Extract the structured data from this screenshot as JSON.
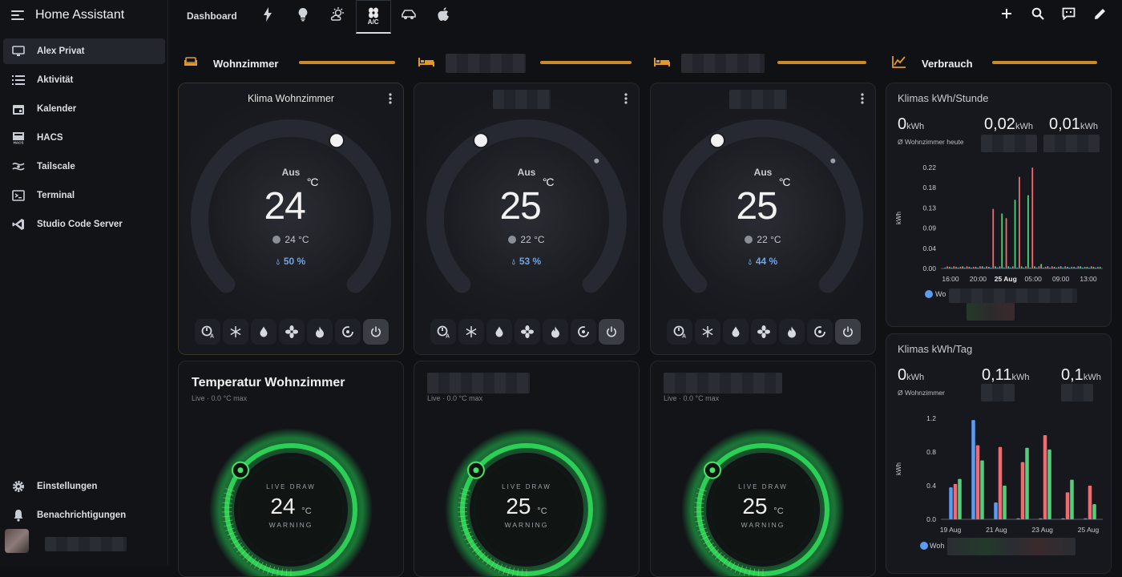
{
  "app": {
    "title": "Home Assistant"
  },
  "sidebar": {
    "items": [
      {
        "label": "Alex Privat",
        "icon": "monitor-icon",
        "active": true
      },
      {
        "label": "Aktivität",
        "icon": "list-icon"
      },
      {
        "label": "Kalender",
        "icon": "calendar-icon"
      },
      {
        "label": "HACS",
        "icon": "hacs-icon"
      },
      {
        "label": "Tailscale",
        "icon": "tailscale-icon"
      },
      {
        "label": "Terminal",
        "icon": "terminal-icon"
      },
      {
        "label": "Studio Code Server",
        "icon": "vscode-icon"
      }
    ],
    "bottom": [
      {
        "label": "Einstellungen",
        "icon": "gear-icon"
      },
      {
        "label": "Benachrichtigungen",
        "icon": "bell-icon"
      }
    ]
  },
  "topbar": {
    "dashboard_label": "Dashboard",
    "tabs": [
      {
        "icon": "lightning-icon"
      },
      {
        "icon": "bulb-icon"
      },
      {
        "icon": "weather-icon"
      },
      {
        "icon": "ac-icon",
        "label": "A/C",
        "active": true
      },
      {
        "icon": "car-icon"
      },
      {
        "icon": "apple-icon"
      }
    ],
    "actions": [
      "add-icon",
      "search-icon",
      "assist-icon",
      "edit-icon"
    ]
  },
  "sections": [
    {
      "title": "Wohnzimmer",
      "icon": "sofa-icon"
    },
    {
      "title": "",
      "icon": "bed-icon"
    },
    {
      "title": "",
      "icon": "bed-icon"
    },
    {
      "title": "Verbrauch",
      "icon": "chart-line-icon"
    }
  ],
  "climate_cards": [
    {
      "name": "Klima Wohnzimmer",
      "state": "Aus",
      "target": "24",
      "unit": "°C",
      "current": "24 °C",
      "humidity": "50 %"
    },
    {
      "name": "",
      "state": "Aus",
      "target": "25",
      "unit": "°C",
      "current": "22 °C",
      "humidity": "53 %"
    },
    {
      "name": "",
      "state": "Aus",
      "target": "25",
      "unit": "°C",
      "current": "22 °C",
      "humidity": "44 %"
    }
  ],
  "mode_icons": [
    "auto-mode-icon",
    "snowflake-icon",
    "water-drop-icon",
    "fan-icon",
    "fire-icon",
    "thermostat-icon",
    "power-icon"
  ],
  "temp_cards": [
    {
      "title": "Temperatur Wohnzimmer",
      "subtitle": "Live · 0.0 °C max",
      "live_label": "LIVE DRAW",
      "value": "24",
      "unit": "°C",
      "status": "WARNING"
    },
    {
      "title": "",
      "subtitle": "Live · 0.0 °C max",
      "live_label": "LIVE DRAW",
      "value": "25",
      "unit": "°C",
      "status": "WARNING"
    },
    {
      "title": "",
      "subtitle": "Live · 0.0 °C max",
      "live_label": "LIVE DRAW",
      "value": "25",
      "unit": "°C",
      "status": "WARNING"
    }
  ],
  "energy_cards": [
    {
      "title": "Klimas kWh/Stunde",
      "values": [
        {
          "v": "0",
          "u": "kWh"
        },
        {
          "v": "0,02",
          "u": "kWh"
        },
        {
          "v": "0,01",
          "u": "kWh"
        }
      ],
      "sub": "Ø Wohnzimmer heute",
      "legend": "Wo"
    },
    {
      "title": "Klimas kWh/Tag",
      "values": [
        {
          "v": "0",
          "u": "kWh"
        },
        {
          "v": "0,11",
          "u": "kWh"
        },
        {
          "v": "0,1",
          "u": "kWh"
        }
      ],
      "sub": "Ø Wohnzimmer",
      "legend": "Woh"
    }
  ],
  "chart_data": [
    {
      "type": "bar",
      "title": "Klimas kWh/Stunde",
      "ylabel": "kWh",
      "ylim": [
        0,
        0.22
      ],
      "yticks": [
        "0.22",
        "0.18",
        "0.13",
        "0.09",
        "0.04",
        "0.00"
      ],
      "xticks": [
        "16:00",
        "20:00",
        "25 Aug",
        "05:00",
        "09:00",
        "13:00"
      ],
      "colors": [
        "#5b9bf0",
        "#f06a6f",
        "#4fd17a"
      ],
      "groups": [
        [
          0,
          0.005,
          0.004
        ],
        [
          0,
          0.005,
          0.004
        ],
        [
          0,
          0.004,
          0.005
        ],
        [
          0,
          0.005,
          0.004
        ],
        [
          0,
          0.004,
          0.004
        ],
        [
          0,
          0.005,
          0.005
        ],
        [
          0,
          0.005,
          0.004
        ],
        [
          0,
          0.13,
          0.005
        ],
        [
          0,
          0.005,
          0.12
        ],
        [
          0,
          0.11,
          0.005
        ],
        [
          0,
          0.005,
          0.15
        ],
        [
          0,
          0.2,
          0.005
        ],
        [
          0,
          0.005,
          0.16
        ],
        [
          0,
          0.22,
          0.005
        ],
        [
          0,
          0.005,
          0.01
        ],
        [
          0,
          0.004,
          0.005
        ],
        [
          0,
          0.005,
          0.004
        ],
        [
          0,
          0.004,
          0.005
        ],
        [
          0,
          0.005,
          0.004
        ],
        [
          0,
          0.004,
          0.004
        ],
        [
          0,
          0.005,
          0.005
        ],
        [
          0,
          0.004,
          0.004
        ],
        [
          0,
          0.005,
          0.004
        ],
        [
          0,
          0.004,
          0.004
        ]
      ]
    },
    {
      "type": "bar",
      "title": "Klimas kWh/Tag",
      "ylabel": "kWh",
      "ylim": [
        0,
        1.2
      ],
      "yticks": [
        "1.2",
        "0.8",
        "0.4",
        "0.0"
      ],
      "xticks": [
        "19 Aug",
        "21 Aug",
        "23 Aug",
        "25 Aug"
      ],
      "colors": [
        "#5b9bf0",
        "#f06a6f",
        "#4fd17a"
      ],
      "groups": [
        [
          0.38,
          0.42,
          0.48
        ],
        [
          1.18,
          0.88,
          0.7
        ],
        [
          0.2,
          0.86,
          0.4
        ],
        [
          0.0,
          0.68,
          0.85
        ],
        [
          0.0,
          1.0,
          0.83
        ],
        [
          0.0,
          0.32,
          0.47
        ],
        [
          0.0,
          0.4,
          0.18
        ]
      ]
    }
  ]
}
